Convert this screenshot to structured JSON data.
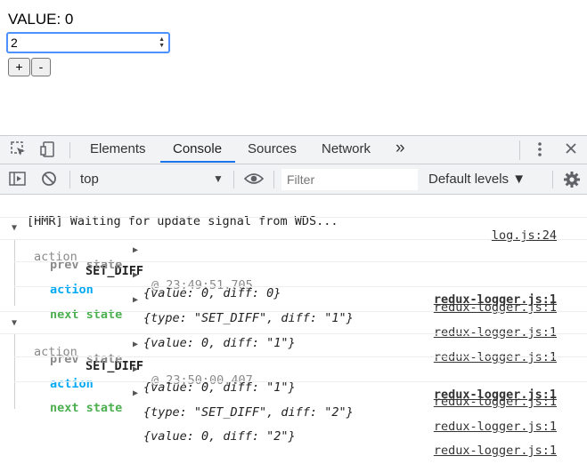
{
  "app": {
    "value_text": "VALUE: 0",
    "input_value": "2",
    "plus_label": "+",
    "minus_label": "-"
  },
  "devtools": {
    "tabs": [
      "Elements",
      "Console",
      "Sources",
      "Network"
    ],
    "active_tab": "Console",
    "more_tabs": "»",
    "context": "top",
    "filter_placeholder": "Filter",
    "levels": "Default levels ▼",
    "accent": "#1a73e8"
  },
  "console": {
    "hmr": {
      "text": "[HMR] Waiting for update signal from WDS...",
      "src": "log.js:24"
    },
    "groups": [
      {
        "header_prefix": "action",
        "action_type": "SET_DIFF",
        "time": "@ 23:49:51.705",
        "src": "redux-logger.js:1",
        "prev_label": "prev state",
        "prev_value": "{value: 0, diff: 0}",
        "action_label": "action",
        "action_value": "{type: \"SET_DIFF\", diff: \"1\"}",
        "next_label": "next state",
        "next_value": "{value: 0, diff: \"1\"}"
      },
      {
        "header_prefix": "action",
        "action_type": "SET_DIFF",
        "time": "@ 23:50:00.407",
        "src": "redux-logger.js:1",
        "prev_label": "prev state",
        "prev_value": "{value: 0, diff: \"1\"}",
        "action_label": "action",
        "action_value": "{type: \"SET_DIFF\", diff: \"2\"}",
        "next_label": "next state",
        "next_value": "{value: 0, diff: \"2\"}"
      }
    ]
  },
  "colors": {
    "prev": "#8a8a8a",
    "action": "#03a9f4",
    "next": "#4caf50"
  }
}
